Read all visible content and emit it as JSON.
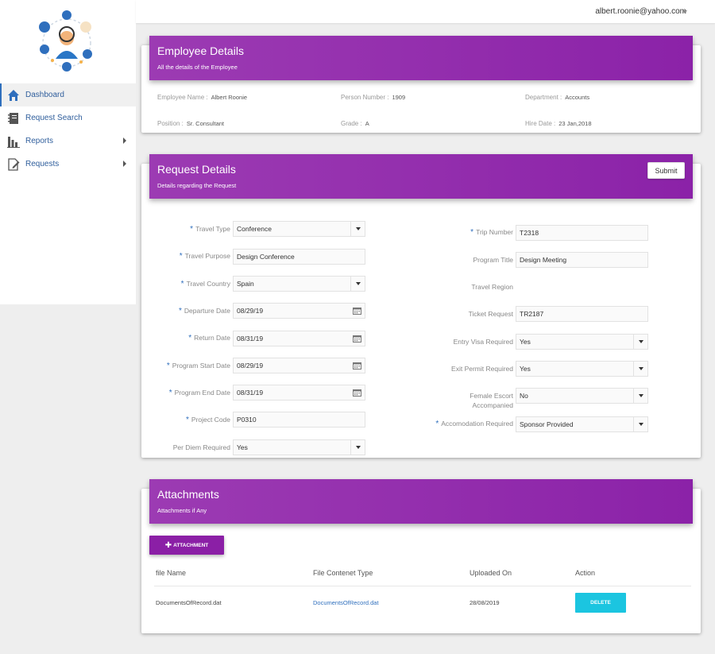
{
  "header": {
    "user_email": "albert.roonie@yahoo.com"
  },
  "sidebar": {
    "items": [
      {
        "label": "Dashboard",
        "icon": "home-icon",
        "active": true
      },
      {
        "label": "Request Search",
        "icon": "notebook-icon"
      },
      {
        "label": "Reports",
        "icon": "bar-chart-icon"
      },
      {
        "label": "Requests",
        "icon": "edit-document-icon"
      }
    ]
  },
  "employee": {
    "title": "Employee Details",
    "subtitle": "All the details of the Employee",
    "fields": {
      "name_label": "Employee Name :",
      "name": "Albert Roonie",
      "person_label": "Person Number :",
      "person": "1909",
      "dept_label": "Department :",
      "dept": "Accounts",
      "position_label": "Position :",
      "position": "Sr. Consultant",
      "grade_label": "Grade :",
      "grade": "A",
      "hire_label": "Hire Date :",
      "hire": "23 Jan,2018"
    }
  },
  "request": {
    "title": "Request Details",
    "subtitle": "Details regarding the Request",
    "submit_label": "Submit",
    "left": [
      {
        "label": "Travel Type",
        "value": "Conference",
        "required": "*"
      },
      {
        "label": "Travel Purpose",
        "value": "Design Conference",
        "required": "*"
      },
      {
        "label": "Travel Country",
        "value": "Spain",
        "required": "*"
      },
      {
        "label": "Departure Date",
        "value": "08/29/19",
        "required": "*"
      },
      {
        "label": "Return Date",
        "value": "08/31/19",
        "required": "*"
      },
      {
        "label": "Program Start Date",
        "value": "08/29/19",
        "required": "*"
      },
      {
        "label": "Program End Date",
        "value": "08/31/19",
        "required": "*"
      },
      {
        "label": "Project Code",
        "value": "P0310",
        "required": "*"
      },
      {
        "label": "Per Diem Required",
        "value": "Yes",
        "required": ""
      }
    ],
    "right": [
      {
        "label": "Trip Number",
        "value": "T2318",
        "required": "*"
      },
      {
        "label": "Program Title",
        "value": "Design Meeting",
        "required": ""
      },
      {
        "label": "Travel Region",
        "value": "",
        "required": ""
      },
      {
        "label": "Ticket Request",
        "value": "TR2187",
        "required": ""
      },
      {
        "label": "Entry Visa Required",
        "value": "Yes",
        "required": ""
      },
      {
        "label": "Exit Permit Required",
        "value": "Yes",
        "required": ""
      },
      {
        "label": "Female Escort",
        "label2": "Accompanied",
        "value": "No",
        "required": ""
      },
      {
        "label": "Accomodation Required",
        "value": "Sponsor Provided",
        "required": "*"
      }
    ]
  },
  "attachments": {
    "title": "Attachments",
    "subtitle": "Attachments if Any",
    "add_label": "ATTACHMENT",
    "columns": [
      "file Name",
      "File Contenet Type",
      "Uploaded On",
      "Action"
    ],
    "rows": [
      {
        "file_name": "DocumentsOfRecord.dat",
        "content_type": "DocumentsOfRecord.dat",
        "uploaded_on": "28/08/2019",
        "action": "DELETE"
      }
    ]
  },
  "colors": {
    "header_purple": "#8b22a8",
    "accent_blue": "#2f6fbd",
    "delete_cyan": "#1bc5e0"
  }
}
